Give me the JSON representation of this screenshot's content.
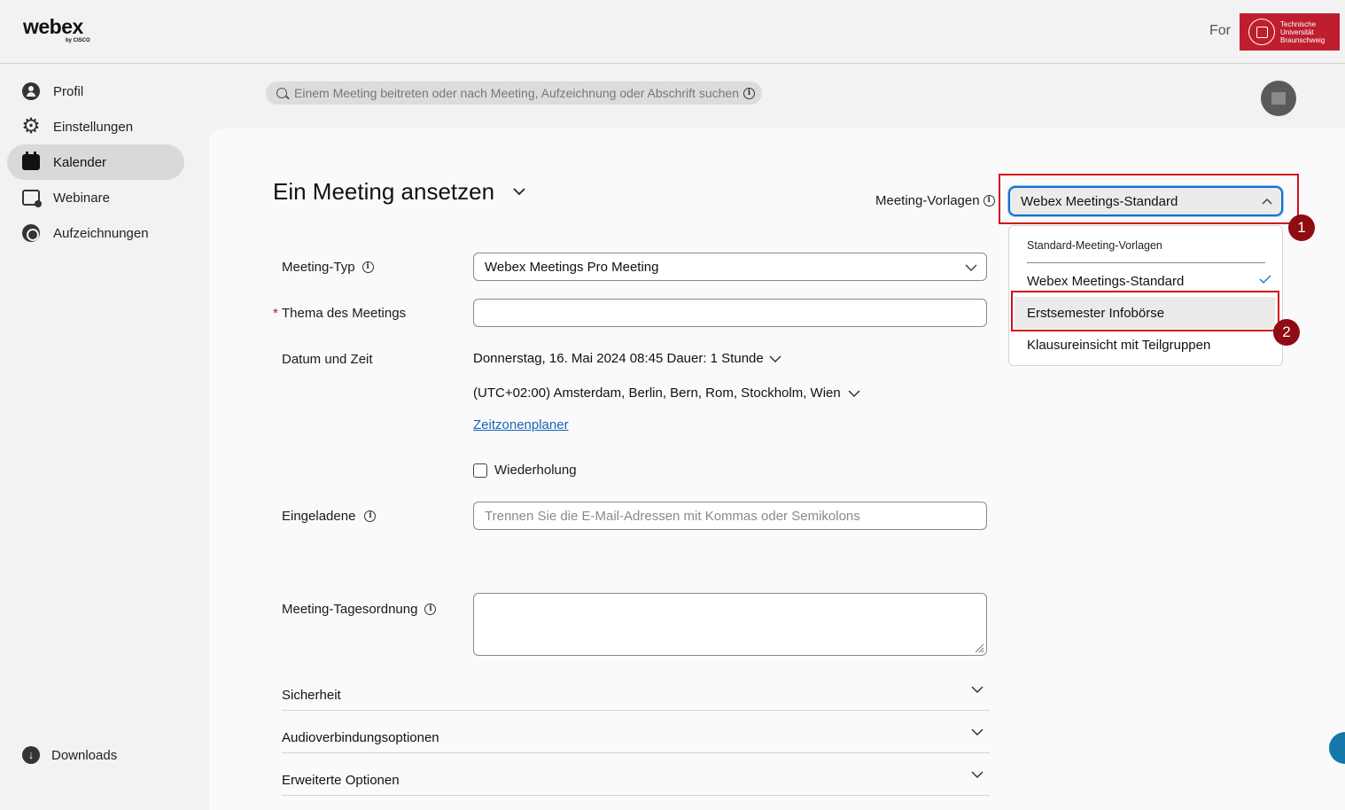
{
  "header": {
    "logo_text": "webex",
    "logo_sub": "by CISCO",
    "for_label": "For",
    "org_logo_text": [
      "Technische",
      "Universität",
      "Braunschweig"
    ]
  },
  "sidebar": {
    "items": [
      {
        "label": "Profil",
        "icon": "profile-icon"
      },
      {
        "label": "Einstellungen",
        "icon": "gear-icon"
      },
      {
        "label": "Kalender",
        "icon": "calendar-icon",
        "active": true
      },
      {
        "label": "Webinare",
        "icon": "webinar-icon"
      },
      {
        "label": "Aufzeichnungen",
        "icon": "recordings-icon"
      }
    ],
    "downloads_label": "Downloads"
  },
  "search": {
    "placeholder": "Einem Meeting beitreten oder nach Meeting, Aufzeichnung oder Abschrift suchen"
  },
  "page": {
    "title": "Ein Meeting ansetzen"
  },
  "templates": {
    "label": "Meeting-Vorlagen",
    "selected": "Webex Meetings-Standard",
    "group_label": "Standard-Meeting-Vorlagen",
    "options": [
      {
        "label": "Webex Meetings-Standard",
        "checked": true
      },
      {
        "label": "Erstsemester Infobörse",
        "hover": true
      },
      {
        "label": "Klausureinsicht mit Teilgruppen"
      }
    ]
  },
  "annotations": {
    "badge_1": "1",
    "badge_2": "2",
    "accent_color": "#d3101a",
    "badge_color": "#8e0c12"
  },
  "form": {
    "meeting_type": {
      "label": "Meeting-Typ",
      "value": "Webex Meetings Pro Meeting"
    },
    "topic": {
      "required_mark": "*",
      "label": "Thema des Meetings",
      "value": ""
    },
    "datetime": {
      "label": "Datum und Zeit",
      "date_line": "Donnerstag, 16. Mai 2024 08:45 Dauer: 1 Stunde",
      "timezone": "(UTC+02:00) Amsterdam, Berlin, Bern, Rom, Stockholm, Wien",
      "planner_link": "Zeitzonenplaner",
      "repeat_label": "Wiederholung",
      "repeat_checked": false
    },
    "invitees": {
      "label": "Eingeladene",
      "placeholder": "Trennen Sie die E-Mail-Adressen mit Kommas oder Semikolons"
    },
    "agenda": {
      "label": "Meeting-Tagesordnung",
      "value": ""
    }
  },
  "sections": [
    {
      "label": "Sicherheit"
    },
    {
      "label": "Audioverbindungsoptionen"
    },
    {
      "label": "Erweiterte Optionen"
    }
  ]
}
